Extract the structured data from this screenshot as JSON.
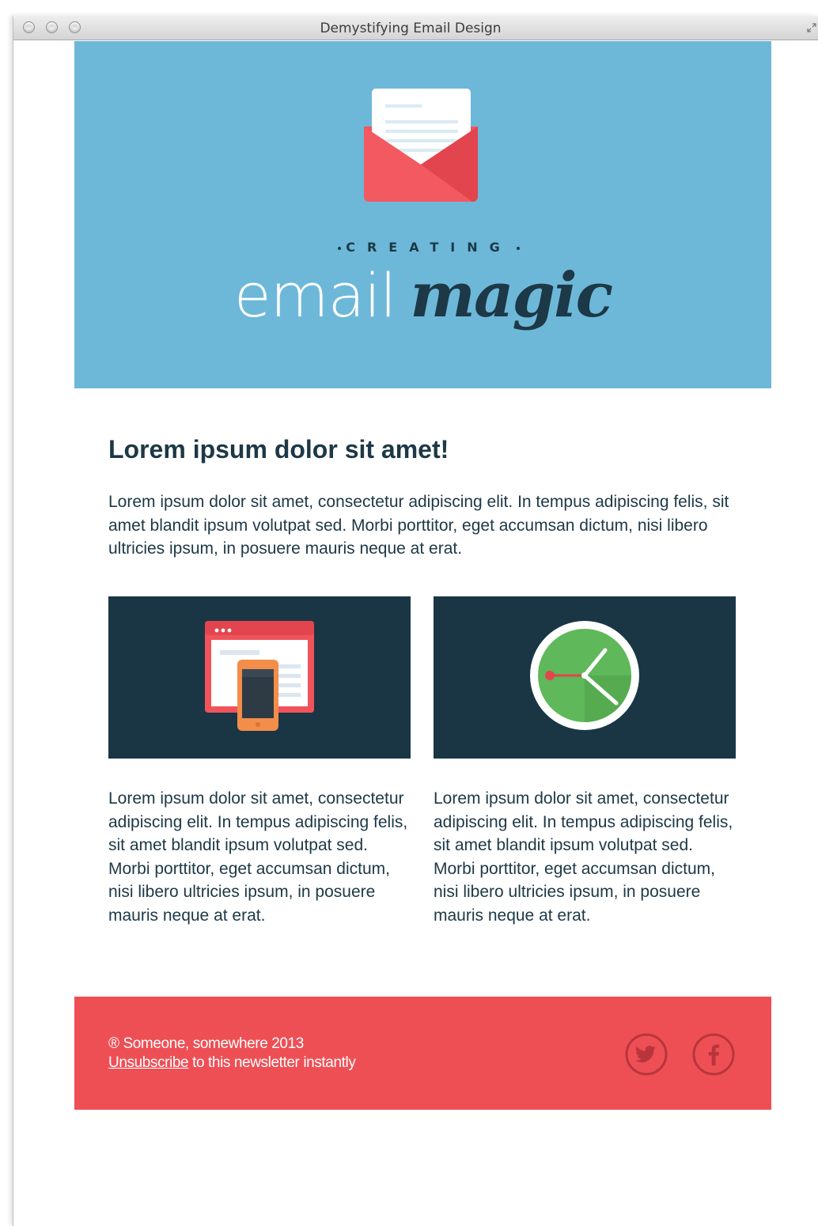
{
  "window": {
    "title": "Demystifying Email Design"
  },
  "hero": {
    "eyebrow": "CREATING",
    "logo_word_1": "email",
    "logo_word_2": "magic",
    "background": "#6db8d9"
  },
  "content": {
    "headline": "Lorem ipsum dolor sit amet!",
    "intro": "Lorem ipsum dolor sit amet, consectetur adipiscing elit. In tempus adipiscing felis, sit amet blandit ipsum volutpat sed. Morbi porttitor, eget accumsan dictum, nisi libero ultricies ipsum, in posuere mauris neque at erat.",
    "columns": [
      {
        "icon": "responsive-devices-icon",
        "text": "Lorem ipsum dolor sit amet, consectetur adipiscing elit. In tempus adipiscing felis, sit amet blandit ipsum volutpat sed. Morbi porttitor, eget accumsan dictum, nisi libero ultricies ipsum, in posuere mauris neque at erat."
      },
      {
        "icon": "clock-icon",
        "text": "Lorem ipsum dolor sit amet, consectetur adipiscing elit. In tempus adipiscing felis, sit amet blandit ipsum volutpat sed. Morbi porttitor, eget accumsan dictum, nisi libero ultricies ipsum, in posuere mauris neque at erat."
      }
    ]
  },
  "footer": {
    "copyright": "® Someone, somewhere 2013",
    "unsubscribe_link": "Unsubscribe",
    "unsubscribe_rest": " to this newsletter instantly",
    "background": "#ee4f55",
    "social": [
      "twitter-icon",
      "facebook-icon"
    ]
  },
  "colors": {
    "navy": "#1d3846",
    "tile": "#1a3645",
    "envelope_red": "#f0535a",
    "clock_green": "#5fb85a",
    "phone_orange": "#f38d4a"
  }
}
